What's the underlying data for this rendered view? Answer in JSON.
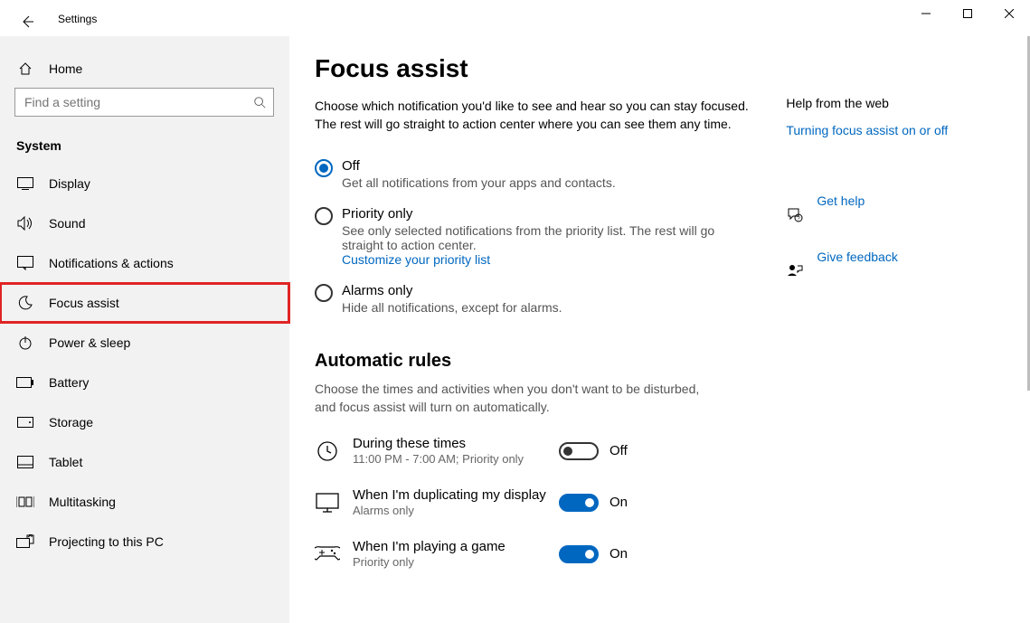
{
  "window": {
    "title": "Settings"
  },
  "sidebar": {
    "home": "Home",
    "search_placeholder": "Find a setting",
    "group": "System",
    "items": [
      {
        "label": "Display"
      },
      {
        "label": "Sound"
      },
      {
        "label": "Notifications & actions"
      },
      {
        "label": "Focus assist"
      },
      {
        "label": "Power & sleep"
      },
      {
        "label": "Battery"
      },
      {
        "label": "Storage"
      },
      {
        "label": "Tablet"
      },
      {
        "label": "Multitasking"
      },
      {
        "label": "Projecting to this PC"
      }
    ]
  },
  "main": {
    "title": "Focus assist",
    "intro": "Choose which notification you'd like to see and hear so you can stay focused. The rest will go straight to action center where you can see them any time.",
    "options": [
      {
        "label": "Off",
        "desc": "Get all notifications from your apps and contacts.",
        "selected": true
      },
      {
        "label": "Priority only",
        "desc": "See only selected notifications from the priority list. The rest will go straight to action center.",
        "link": "Customize your priority list",
        "selected": false
      },
      {
        "label": "Alarms only",
        "desc": "Hide all notifications, except for alarms.",
        "selected": false
      }
    ],
    "rules_title": "Automatic rules",
    "rules_intro": "Choose the times and activities when you don't want to be disturbed, and focus assist will turn on automatically.",
    "rules": [
      {
        "label": "During these times",
        "desc": "11:00 PM - 7:00 AM; Priority only",
        "on": false,
        "state": "Off"
      },
      {
        "label": "When I'm duplicating my display",
        "desc": "Alarms only",
        "on": true,
        "state": "On"
      },
      {
        "label": "When I'm playing a game",
        "desc": "Priority only",
        "on": true,
        "state": "On"
      }
    ]
  },
  "aside": {
    "help_title": "Help from the web",
    "help_link": "Turning focus assist on or off",
    "get_help": "Get help",
    "feedback": "Give feedback"
  }
}
